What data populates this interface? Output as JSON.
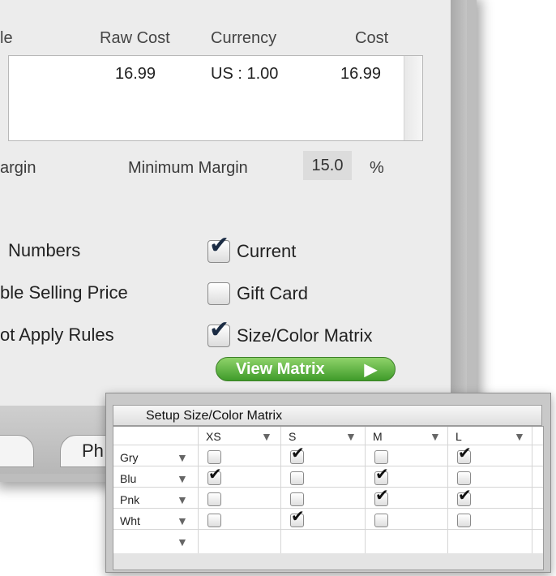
{
  "cost_table": {
    "headers": [
      "le",
      "Raw Cost",
      "Currency",
      "Cost"
    ],
    "row": {
      "raw_cost": "16.99",
      "currency": "US : 1.00",
      "cost": "16.99"
    }
  },
  "margin": {
    "left_label": "argin",
    "minimum_label": "Minimum Margin",
    "minimum_value": "15.0",
    "unit": "%"
  },
  "left_options": [
    "Numbers",
    "ble Selling Price",
    "ot Apply Rules"
  ],
  "checkboxes": [
    {
      "label": "Current",
      "checked": true
    },
    {
      "label": "Gift Card",
      "checked": false
    },
    {
      "label": "Size/Color Matrix",
      "checked": true
    }
  ],
  "view_matrix_button": {
    "label": "View Matrix",
    "arrow": "▶"
  },
  "bottom_tab": {
    "label": "Ph"
  },
  "matrix": {
    "title": "Setup Size/Color Matrix",
    "sizes": [
      "XS",
      "S",
      "M",
      "L"
    ],
    "colors": [
      "Gry",
      "Blu",
      "Pnk",
      "Wht"
    ],
    "checked": [
      [
        false,
        true,
        false,
        true
      ],
      [
        true,
        false,
        true,
        false
      ],
      [
        false,
        false,
        true,
        true
      ],
      [
        false,
        true,
        false,
        false
      ]
    ]
  },
  "icons": [
    "dropdown-triangle-icon",
    "play-arrow-icon",
    "checkmark-icon"
  ]
}
